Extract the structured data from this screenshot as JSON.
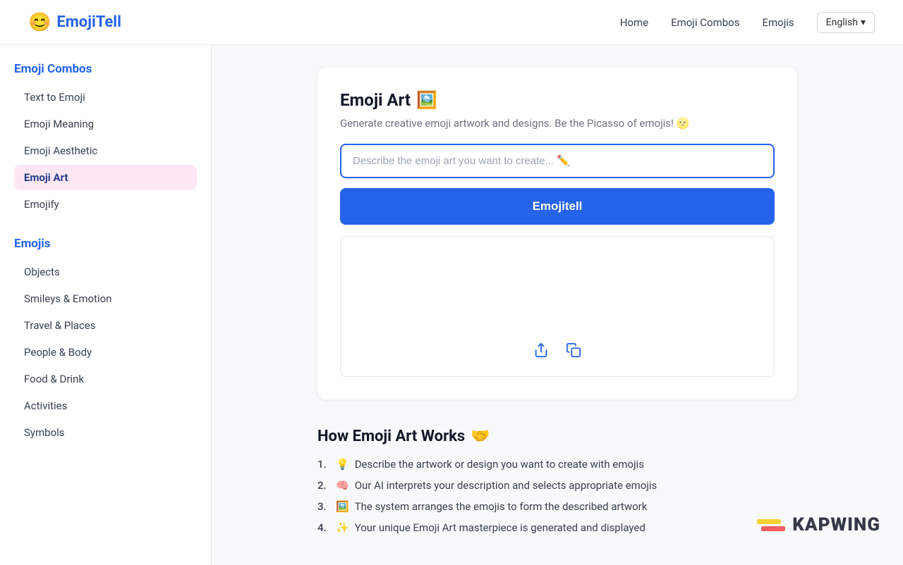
{
  "navbar": {
    "logo_icon": "😊",
    "logo_text": "EmojiTell",
    "links": [
      {
        "label": "Home",
        "name": "nav-home"
      },
      {
        "label": "Emoji Combos",
        "name": "nav-emoji-combos"
      },
      {
        "label": "Emojis",
        "name": "nav-emojis"
      }
    ],
    "language": "English",
    "language_icon": "▾"
  },
  "sidebar": {
    "sections": [
      {
        "title": "Emoji Combos",
        "name": "emoji-combos",
        "items": [
          {
            "label": "Text to Emoji",
            "active": false
          },
          {
            "label": "Emoji Meaning",
            "active": false
          },
          {
            "label": "Emoji Aesthetic",
            "active": false
          },
          {
            "label": "Emoji Art",
            "active": true
          },
          {
            "label": "Emojify",
            "active": false
          }
        ]
      },
      {
        "title": "Emojis",
        "name": "emojis",
        "items": [
          {
            "label": "Objects",
            "active": false
          },
          {
            "label": "Smileys & Emotion",
            "active": false
          },
          {
            "label": "Travel & Places",
            "active": false
          },
          {
            "label": "People & Body",
            "active": false
          },
          {
            "label": "Food & Drink",
            "active": false
          },
          {
            "label": "Activities",
            "active": false
          },
          {
            "label": "Symbols",
            "active": false
          }
        ]
      }
    ]
  },
  "main": {
    "card": {
      "title": "Emoji Art",
      "title_icon": "🖼️",
      "subtitle": "Generate creative emoji artwork and designs. Be the Picasso of emojis! 🌝",
      "input_placeholder": "Describe the emoji art you want to create... ✏️",
      "button_label": "Emojitell",
      "output_share_icon": "⬆",
      "output_copy_icon": "⧉"
    },
    "how_section": {
      "title": "How Emoji Art Works",
      "title_icon": "🤝",
      "steps": [
        {
          "number": "1.",
          "icon": "💡",
          "text": "Describe the artwork or design you want to create with emojis"
        },
        {
          "number": "2.",
          "icon": "🧠",
          "text": "Our AI interprets your description and selects appropriate emojis"
        },
        {
          "number": "3.",
          "icon": "🖼️",
          "text": "The system arranges the emojis to form the described artwork"
        },
        {
          "number": "4.",
          "icon": "✨",
          "text": "Your unique Emoji Art masterpiece is generated and displayed"
        }
      ]
    }
  },
  "watermark": {
    "text": "KAPWING"
  }
}
